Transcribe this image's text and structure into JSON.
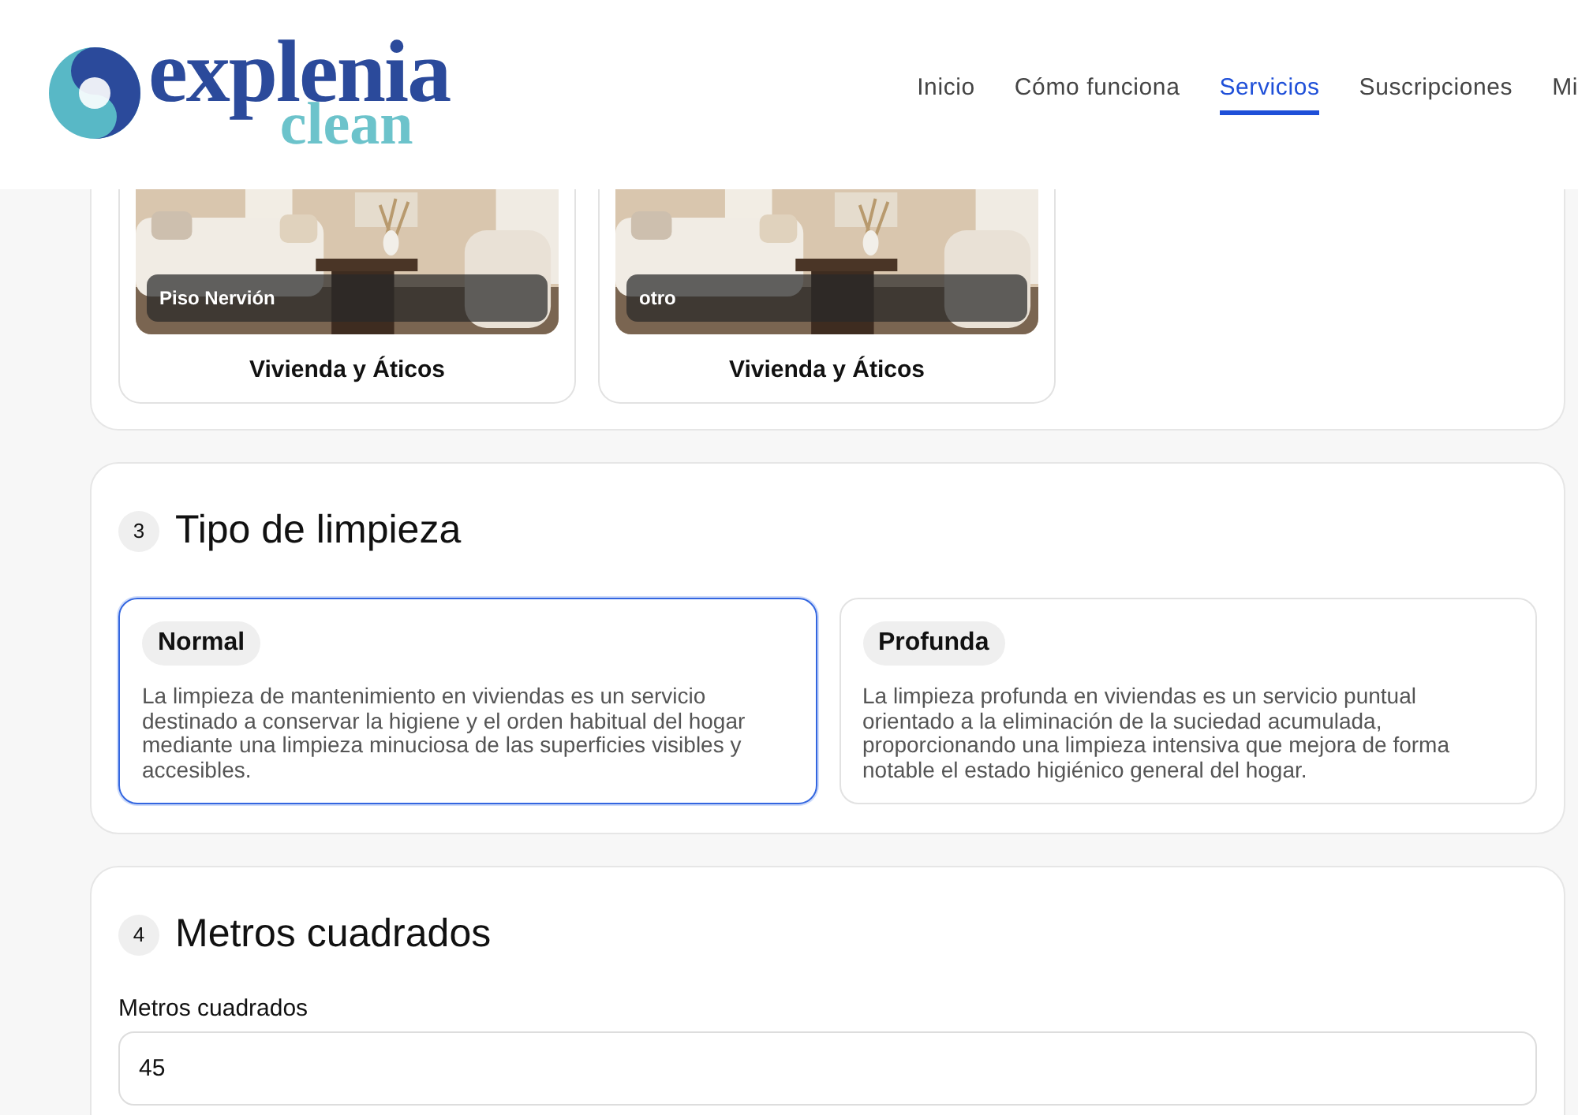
{
  "header": {
    "logo": {
      "word": "explenia",
      "sub": "clean"
    },
    "nav": [
      {
        "label": "Inicio",
        "selected": false
      },
      {
        "label": "Cómo funciona",
        "selected": false
      },
      {
        "label": "Servicios",
        "selected": true
      },
      {
        "label": "Suscripciones",
        "selected": false
      },
      {
        "label": "Mi",
        "selected": false
      }
    ]
  },
  "properties": [
    {
      "caption": "Piso Nervión",
      "title": "Vivienda y Áticos"
    },
    {
      "caption": "otro",
      "title": "Vivienda y Áticos"
    }
  ],
  "cleaning": {
    "step": "3",
    "title": "Tipo de limpieza",
    "options": [
      {
        "name": "Normal",
        "description": "La limpieza de mantenimiento en viviendas es un servicio destinado a conservar la higiene y el orden habitual del hogar mediante una limpieza minuciosa de las superficies visibles y accesibles.",
        "selected": true
      },
      {
        "name": "Profunda",
        "description": "La limpieza profunda en viviendas es un servicio puntual orientado a la eliminación de la suciedad acumulada, proporcionando una limpieza intensiva que mejora de forma notable el estado higiénico general del hogar.",
        "selected": false
      }
    ]
  },
  "area": {
    "step": "4",
    "title": "Metros cuadrados",
    "label": "Metros cuadrados",
    "value": "45"
  }
}
